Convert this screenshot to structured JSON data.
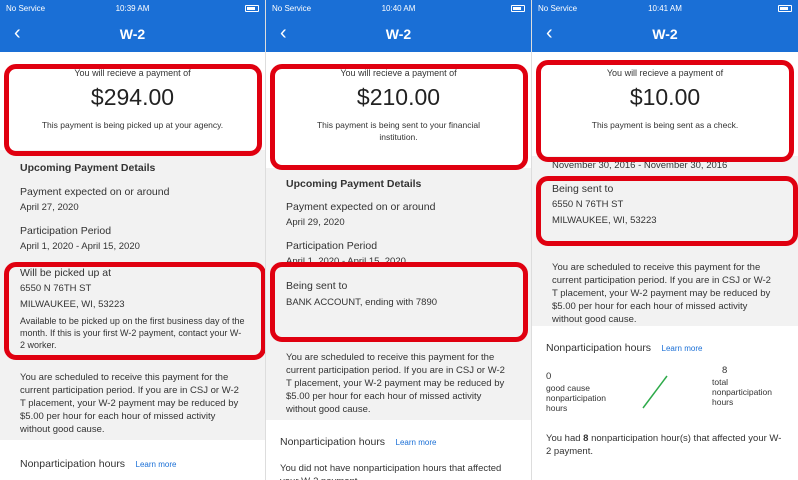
{
  "panels": [
    {
      "status": {
        "carrier": "No Service",
        "time": "10:39 AM"
      },
      "nav": {
        "back": "‹",
        "title": "W-2"
      },
      "payment": {
        "label": "You will recieve a payment of",
        "amount": "$294.00",
        "note": "This payment is being picked up at your agency."
      },
      "upcoming": "Upcoming Payment Details",
      "expected_label": "Payment expected on or around",
      "expected_date": "April 27, 2020",
      "period_label": "Participation Period",
      "period": "April 1, 2020 - April 15, 2020",
      "destination": {
        "label": "Will be picked up at",
        "line1": "6550 N 76TH ST",
        "line2": "MILWAUKEE, WI, 53223",
        "note": "Available to be picked up on the first business day of the month. If this is your first W-2 payment, contact your W-2 worker."
      },
      "schedule_note": "You are scheduled to receive this payment for the current participation period. If you are in CSJ or W-2 T placement, your W-2 payment may be reduced by $5.00 per hour for each hour of missed activity without good cause.",
      "np_title": "Nonparticipation hours",
      "np_link": "Learn more"
    },
    {
      "status": {
        "carrier": "No Service",
        "time": "10:40 AM"
      },
      "nav": {
        "back": "‹",
        "title": "W-2"
      },
      "payment": {
        "label": "You will recieve a payment of",
        "amount": "$210.00",
        "note": "This payment is being sent to your financial institution."
      },
      "upcoming": "Upcoming Payment Details",
      "expected_label": "Payment expected on or around",
      "expected_date": "April 29, 2020",
      "period_label": "Participation Period",
      "period": "April 1, 2020 - April 15, 2020",
      "destination": {
        "label": "Being sent to",
        "line1": "BANK ACCOUNT, ending with 7890"
      },
      "schedule_note": "You are scheduled to receive this payment for the current participation period. If you are in CSJ or W-2 T placement, your W-2 payment may be reduced by $5.00 per hour for each hour of missed activity without good cause.",
      "np_title": "Nonparticipation hours",
      "np_link": "Learn more",
      "np_text": "You did not have nonparticipation hours that affected your W-2 payment."
    },
    {
      "status": {
        "carrier": "No Service",
        "time": "10:41 AM"
      },
      "nav": {
        "back": "‹",
        "title": "W-2"
      },
      "payment": {
        "label": "You will recieve a payment of",
        "amount": "$10.00",
        "note": "This payment is being sent as a check."
      },
      "period": "November 30, 2016 - November 30, 2016",
      "destination": {
        "label": "Being sent to",
        "line1": "6550 N 76TH ST",
        "line2": "MILWAUKEE, WI, 53223"
      },
      "schedule_note": "You are scheduled to receive this payment for the current participation period. If you are in CSJ or W-2 T placement, your W-2 payment may be reduced by $5.00 per hour for each hour of missed activity without good cause.",
      "np_title": "Nonparticipation hours",
      "np_link": "Learn more",
      "np_left_value": "0",
      "np_left_label": "good cause nonparticipation hours",
      "np_right_value": "8",
      "np_right_label": "total nonparticipation hours",
      "np_summary_pre": "You had ",
      "np_summary_num": "8",
      "np_summary_post": " nonparticipation hour(s) that affected your W-2 payment."
    }
  ],
  "colors": {
    "accent": "#1a6fd6",
    "highlight": "#e00010",
    "background": "#f2f2f2"
  }
}
